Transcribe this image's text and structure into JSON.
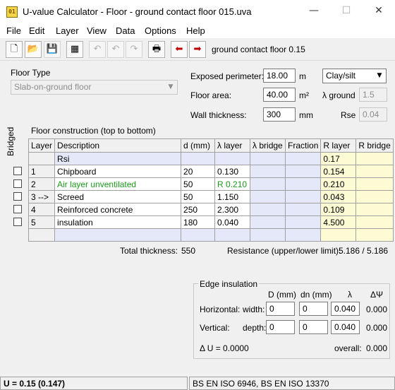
{
  "window": {
    "title": "U-value Calculator - Floor - ground contact floor 015.uva",
    "app_icon_text": "01",
    "minimize": "—",
    "maximize": "☐",
    "close": "✕"
  },
  "menu": [
    "File",
    "Edit",
    "Layer",
    "View",
    "Data",
    "Options",
    "Help"
  ],
  "toolbar": {
    "buttons": [
      {
        "name": "new-icon",
        "glyph": "🗋",
        "enabled": true
      },
      {
        "name": "open-folder-icon",
        "glyph": "📂",
        "enabled": true
      },
      {
        "name": "save-icon",
        "glyph": "💾",
        "enabled": false
      },
      {
        "name": "table-icon",
        "glyph": "▦",
        "enabled": true
      },
      {
        "name": "undo-icon",
        "glyph": "↶",
        "enabled": false
      },
      {
        "name": "undo-step-icon",
        "glyph": "↶",
        "enabled": false
      },
      {
        "name": "redo-icon",
        "glyph": "↷",
        "enabled": false
      },
      {
        "name": "print-icon",
        "glyph": "🖶",
        "enabled": true
      },
      {
        "name": "arrow-left-icon",
        "glyph": "⬅",
        "enabled": true
      },
      {
        "name": "arrow-right-icon",
        "glyph": "➡",
        "enabled": true
      }
    ],
    "caption": "ground contact floor 0.15",
    "arrow_color": "#c00000"
  },
  "floor_type": {
    "label": "Floor Type",
    "value": "Slab-on-ground floor"
  },
  "params": {
    "exposed_perimeter_label": "Exposed perimeter:",
    "exposed_perimeter_value": "18.00",
    "exposed_perimeter_unit": "m",
    "floor_area_label": "Floor area:",
    "floor_area_value": "40.00",
    "floor_area_unit": "m²",
    "wall_thickness_label": "Wall thickness:",
    "wall_thickness_value": "300",
    "wall_thickness_unit": "mm",
    "soil_value": "Clay/silt",
    "lambda_ground_label": "λ ground",
    "lambda_ground_value": "1.5",
    "rse_label": "Rse",
    "rse_value": "0.04"
  },
  "construction": {
    "caption": "Floor construction (top to bottom)",
    "bridged_label": "Bridged",
    "columns": [
      "Layer",
      "Description",
      "d (mm)",
      "λ layer",
      "λ bridge",
      "Fraction",
      "R layer",
      "R bridge"
    ],
    "rows": [
      {
        "layer": "",
        "description": "Rsi",
        "d": "",
        "lambda": "",
        "lambda_bridge": "",
        "fraction": "",
        "r_layer": "0.17",
        "r_bridge": "",
        "checkbox": false,
        "green": false
      },
      {
        "layer": "1",
        "description": "Chipboard",
        "d": "20",
        "lambda": "0.130",
        "lambda_bridge": "",
        "fraction": "",
        "r_layer": "0.154",
        "r_bridge": "",
        "checkbox": true,
        "green": false
      },
      {
        "layer": "2",
        "description": "Air layer unventilated",
        "d": "50",
        "lambda": "R 0.210",
        "lambda_bridge": "",
        "fraction": "",
        "r_layer": "0.210",
        "r_bridge": "",
        "checkbox": true,
        "green": true
      },
      {
        "layer": "3 -->",
        "description": "Screed",
        "d": "50",
        "lambda": "1.150",
        "lambda_bridge": "",
        "fraction": "",
        "r_layer": "0.043",
        "r_bridge": "",
        "checkbox": true,
        "green": false
      },
      {
        "layer": "4",
        "description": "Reinforced concrete",
        "d": "250",
        "lambda": "2.300",
        "lambda_bridge": "",
        "fraction": "",
        "r_layer": "0.109",
        "r_bridge": "",
        "checkbox": true,
        "green": false
      },
      {
        "layer": "5",
        "description": "insulation",
        "d": "180",
        "lambda": "0.040",
        "lambda_bridge": "",
        "fraction": "",
        "r_layer": "4.500",
        "r_bridge": "",
        "checkbox": true,
        "green": false
      },
      {
        "layer": "",
        "description": "",
        "d": "",
        "lambda": "",
        "lambda_bridge": "",
        "fraction": "",
        "r_layer": "",
        "r_bridge": "",
        "checkbox": false,
        "green": false
      }
    ],
    "total_thickness_label": "Total thickness:",
    "total_thickness_value": "550",
    "resistance_label": "Resistance (upper/lower limit):",
    "resistance_value": "5.186 / 5.186"
  },
  "edge": {
    "legend": "Edge insulation",
    "col_d": "D (mm)",
    "col_dn": "dn (mm)",
    "col_lambda": "λ",
    "col_dpsi": "ΔΨ",
    "horizontal_label": "Horizontal:",
    "width_label": "width:",
    "h_d": "0",
    "h_dn": "0",
    "h_lambda": "0.040",
    "h_dpsi": "0.000",
    "vertical_label": "Vertical:",
    "depth_label": "depth:",
    "v_d": "0",
    "v_dn": "0",
    "v_lambda": "0.040",
    "v_dpsi": "0.000",
    "delta_u": "Δ U = 0.0000",
    "overall_label": "overall:",
    "overall_value": "0.000"
  },
  "status": {
    "u_value": "U = 0.15  (0.147)",
    "standards": "BS EN ISO 6946, BS EN ISO 13370"
  }
}
